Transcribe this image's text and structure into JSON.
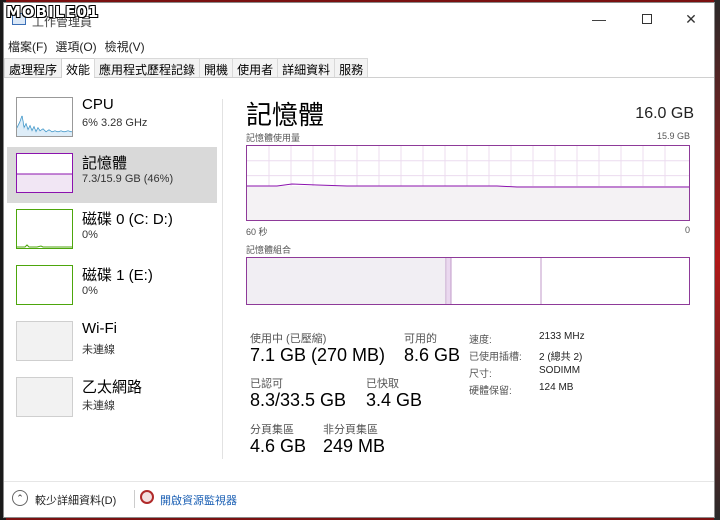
{
  "watermark": "MOBILE01",
  "window": {
    "title": "工作管理員"
  },
  "menu": [
    "檔案(F)",
    "選項(O)",
    "檢視(V)"
  ],
  "tabs": [
    {
      "label": "處理程序"
    },
    {
      "label": "效能",
      "active": true
    },
    {
      "label": "應用程式歷程記錄"
    },
    {
      "label": "開機"
    },
    {
      "label": "使用者"
    },
    {
      "label": "詳細資料"
    },
    {
      "label": "服務"
    }
  ],
  "sidebar": {
    "items": [
      {
        "name": "CPU",
        "sub": "6%  3.28 GHz",
        "graph_color": "#117dbb"
      },
      {
        "name": "記憶體",
        "sub": "7.3/15.9 GB (46%)",
        "graph_color": "#8b12ae",
        "selected": true
      },
      {
        "name": "磁碟 0 (C: D:)",
        "sub": "0%",
        "graph_color": "#4da60c"
      },
      {
        "name": "磁碟 1 (E:)",
        "sub": "0%",
        "graph_color": "#4da60c"
      },
      {
        "name": "Wi-Fi",
        "sub": "未連線",
        "graph_color": "#a74f01"
      },
      {
        "name": "乙太網路",
        "sub": "未連線",
        "graph_color": "#a74f01"
      }
    ]
  },
  "memory": {
    "title": "記憶體",
    "total": "16.0 GB",
    "usage_label": "記憶體使用量",
    "usage_max": "15.9 GB",
    "time_label": "60 秒",
    "time_end": "0",
    "composition_label": "記憶體組合",
    "usage_level": 0.46,
    "stats": {
      "in_use_label": "使用中 (已壓縮)",
      "in_use_value": "7.1 GB (270 MB)",
      "available_label": "可用的",
      "available_value": "8.6 GB",
      "committed_label": "已認可",
      "committed_value": "8.3/33.5 GB",
      "cached_label": "已快取",
      "cached_value": "3.4 GB",
      "paged_label": "分頁集區",
      "paged_value": "4.6 GB",
      "nonpaged_label": "非分頁集區",
      "nonpaged_value": "249 MB"
    },
    "details": [
      {
        "label": "速度:",
        "value": "2133 MHz"
      },
      {
        "label": "已使用插槽:",
        "value": "2 (總共 2)"
      },
      {
        "label": "尺寸:",
        "value": "SODIMM"
      },
      {
        "label": "硬體保留:",
        "value": "124 MB"
      }
    ]
  },
  "footer": {
    "fewer_details": "較少詳細資料(D)",
    "open_monitor": "開啟資源監視器"
  },
  "colors": {
    "memory_accent": "#8b12ae",
    "memory_fill": "#f4f2f4",
    "link": "#1a5fb4"
  }
}
